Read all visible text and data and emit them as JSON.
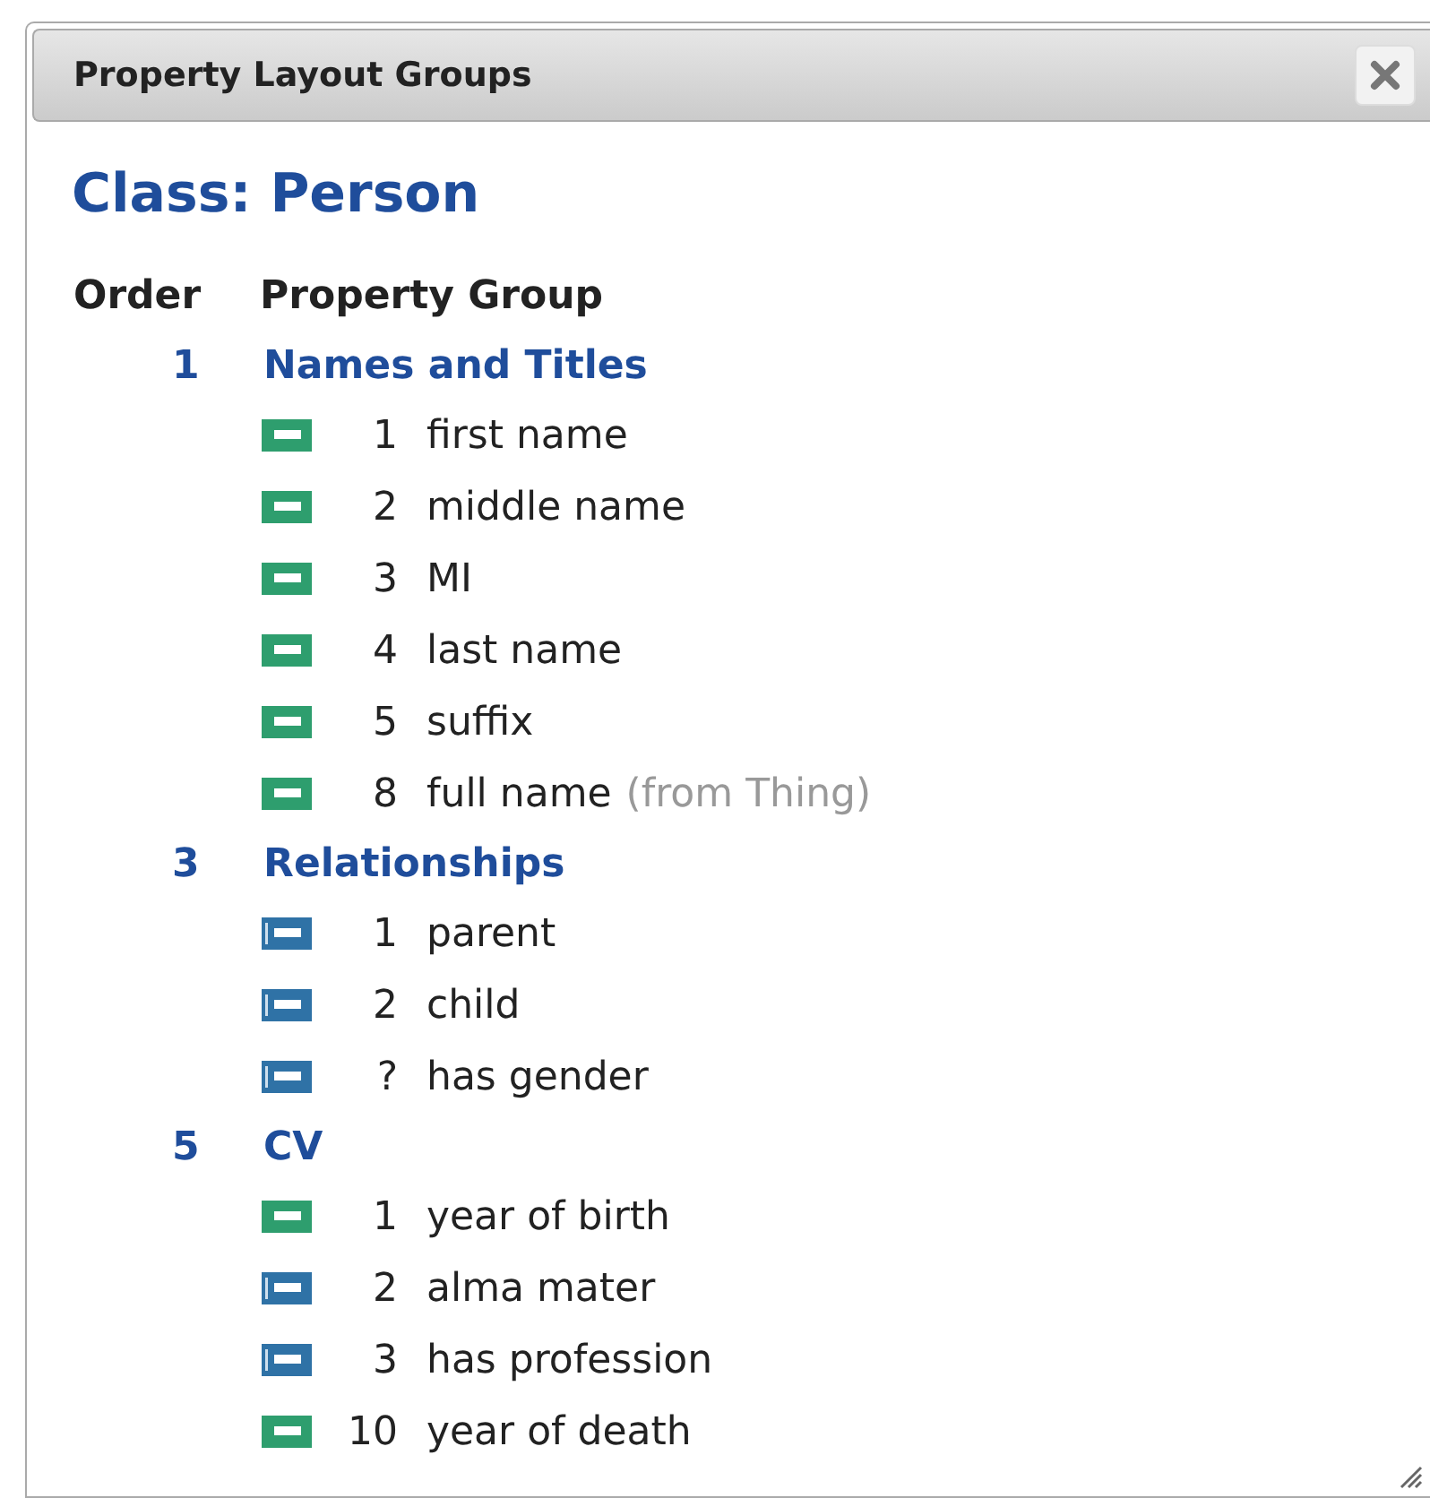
{
  "dialog": {
    "title": "Property Layout Groups"
  },
  "class_heading": "Class: Person",
  "columns": [
    "Order",
    "Property Group"
  ],
  "groups": [
    {
      "order": "1",
      "name": "Names and Titles",
      "properties": [
        {
          "kind": "data",
          "order": "1",
          "name": "first name"
        },
        {
          "kind": "data",
          "order": "2",
          "name": "middle name"
        },
        {
          "kind": "data",
          "order": "3",
          "name": "MI"
        },
        {
          "kind": "data",
          "order": "4",
          "name": "last name"
        },
        {
          "kind": "data",
          "order": "5",
          "name": "suffix"
        },
        {
          "kind": "data",
          "order": "8",
          "name": "full name",
          "source": "(from Thing)"
        }
      ]
    },
    {
      "order": "3",
      "name": "Relationships",
      "properties": [
        {
          "kind": "object",
          "order": "1",
          "name": "parent"
        },
        {
          "kind": "object",
          "order": "2",
          "name": "child"
        },
        {
          "kind": "object",
          "order": "?",
          "name": "has gender"
        }
      ]
    },
    {
      "order": "5",
      "name": "CV",
      "properties": [
        {
          "kind": "data",
          "order": "1",
          "name": "year of birth"
        },
        {
          "kind": "object",
          "order": "2",
          "name": "alma mater"
        },
        {
          "kind": "object",
          "order": "3",
          "name": "has profession"
        },
        {
          "kind": "data",
          "order": "10",
          "name": "year of death"
        }
      ]
    }
  ]
}
